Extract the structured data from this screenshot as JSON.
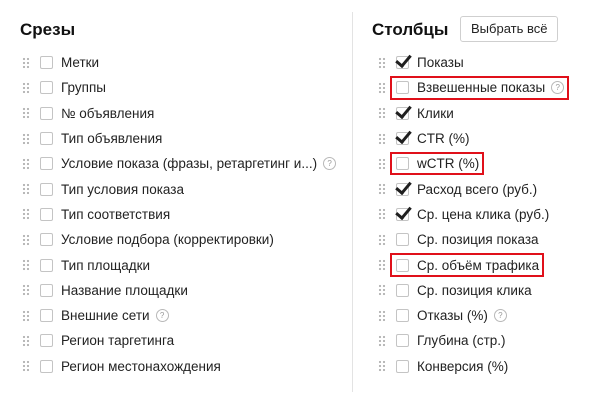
{
  "left": {
    "title": "Срезы",
    "items": [
      {
        "label": "Метки",
        "checked": false,
        "help": false
      },
      {
        "label": "Группы",
        "checked": false,
        "help": false
      },
      {
        "label": "№ объявления",
        "checked": false,
        "help": false
      },
      {
        "label": "Тип объявления",
        "checked": false,
        "help": false
      },
      {
        "label": "Условие показа (фразы, ретаргетинг и...)",
        "checked": false,
        "help": true
      },
      {
        "label": "Тип условия показа",
        "checked": false,
        "help": false
      },
      {
        "label": "Тип соответствия",
        "checked": false,
        "help": false
      },
      {
        "label": "Условие подбора (корректировки)",
        "checked": false,
        "help": false
      },
      {
        "label": "Тип площадки",
        "checked": false,
        "help": false
      },
      {
        "label": "Название площадки",
        "checked": false,
        "help": false
      },
      {
        "label": "Внешние сети",
        "checked": false,
        "help": true
      },
      {
        "label": "Регион таргетинга",
        "checked": false,
        "help": false
      },
      {
        "label": "Регион местонахождения",
        "checked": false,
        "help": false
      }
    ]
  },
  "right": {
    "title": "Столбцы",
    "select_all_label": "Выбрать всё",
    "items": [
      {
        "label": "Показы",
        "checked": true,
        "help": false,
        "highlight": false
      },
      {
        "label": "Взвешенные показы",
        "checked": false,
        "help": true,
        "highlight": true
      },
      {
        "label": "Клики",
        "checked": true,
        "help": false,
        "highlight": false
      },
      {
        "label": "CTR (%)",
        "checked": true,
        "help": false,
        "highlight": false
      },
      {
        "label": "wCTR (%)",
        "checked": false,
        "help": false,
        "highlight": true
      },
      {
        "label": "Расход всего (руб.)",
        "checked": true,
        "help": false,
        "highlight": false
      },
      {
        "label": "Ср. цена клика (руб.)",
        "checked": true,
        "help": false,
        "highlight": false
      },
      {
        "label": "Ср. позиция показа",
        "checked": false,
        "help": false,
        "highlight": false
      },
      {
        "label": "Ср. объём трафика",
        "checked": false,
        "help": false,
        "highlight": true
      },
      {
        "label": "Ср. позиция клика",
        "checked": false,
        "help": false,
        "highlight": false
      },
      {
        "label": "Отказы (%)",
        "checked": false,
        "help": true,
        "highlight": false
      },
      {
        "label": "Глубина (стр.)",
        "checked": false,
        "help": false,
        "highlight": false
      },
      {
        "label": "Конверсия (%)",
        "checked": false,
        "help": false,
        "highlight": false
      }
    ]
  },
  "colors": {
    "highlight": "#e0101a",
    "divider": "#e3e3e3",
    "checkbox_border": "#c4c4c4"
  },
  "icons": {
    "drag": "drag-handle-icon",
    "help": "question-circle-icon",
    "check": "checkmark-icon"
  }
}
